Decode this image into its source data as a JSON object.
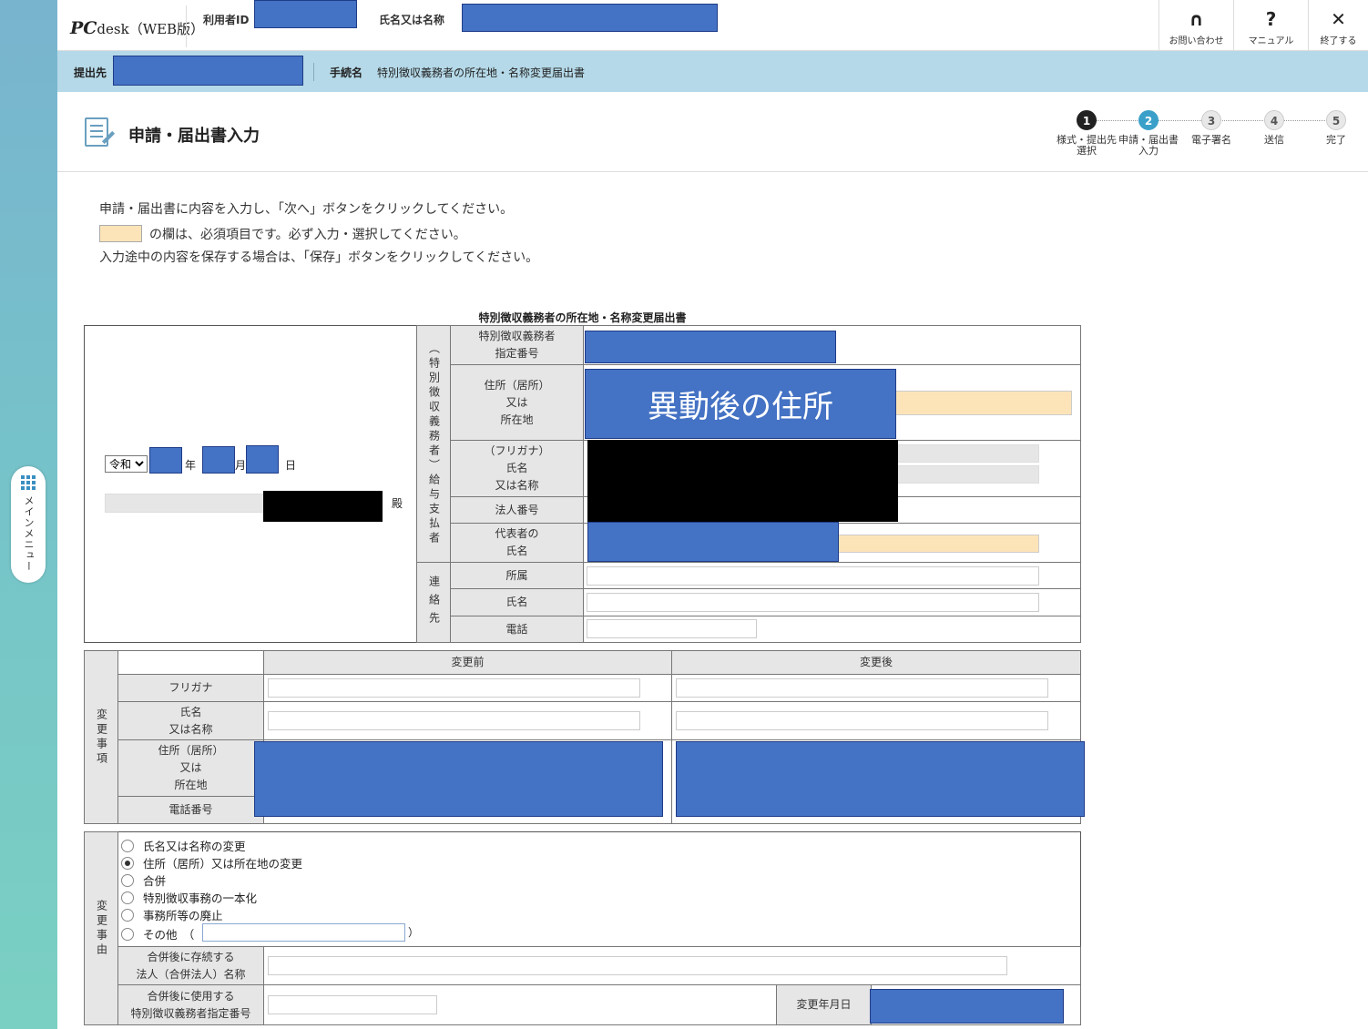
{
  "side": {
    "menu_label": "メインメニュー"
  },
  "header": {
    "logo_main": "PC",
    "logo_rest": "desk（WEB版）",
    "user_id_label": "利用者ID",
    "name_label": "氏名又は名称",
    "buttons": [
      {
        "icon": "headset-icon",
        "glyph": "🎧",
        "label": "お問い合わせ"
      },
      {
        "icon": "question-icon",
        "glyph": "?",
        "label": "マニュアル"
      },
      {
        "icon": "close-icon",
        "glyph": "✕",
        "label": "終了する"
      }
    ]
  },
  "subheader": {
    "dest_label": "提出先",
    "proc_label": "手続名",
    "proc_name": "特別徴収義務者の所在地・名称変更届出書"
  },
  "page": {
    "title": "申請・届出書入力"
  },
  "steps": [
    {
      "num": "1",
      "label": "様式・提出先\n選択",
      "state": "done"
    },
    {
      "num": "2",
      "label": "申請・届出書\n入力",
      "state": "current"
    },
    {
      "num": "3",
      "label": "電子署名",
      "state": "todo"
    },
    {
      "num": "4",
      "label": "送信",
      "state": "todo"
    },
    {
      "num": "5",
      "label": "完了",
      "state": "todo"
    }
  ],
  "instructions": {
    "line1": "申請・届出書に内容を入力し、「次へ」ボタンをクリックしてください。",
    "line2": "の欄は、必須項目です。必ず入力・選択してください。",
    "line3": "入力途中の内容を保存する場合は、「保存」ボタンをクリックしてください。"
  },
  "form": {
    "title": "特別徴収義務者の所在地・名称変更届出書",
    "era": "令和",
    "year_unit": "年",
    "month_unit": "月",
    "day_unit": "日",
    "addressee_suffix": "殿",
    "payer_group": "（特別徴収義務者）給与支払者",
    "payer_designated_no": "特別徴収義務者\n指定番号",
    "payer_address": "住所（居所）\n又は\n所在地",
    "address_annotation": "異動後の住所",
    "payer_name": "（フリガナ）\n氏名\n又は名称",
    "corp_no": "法人番号",
    "rep_name": "代表者の\n氏名",
    "contact_group": "連絡先",
    "contact_dept": "所属",
    "contact_name": "氏名",
    "contact_tel": "電話"
  },
  "changes": {
    "group": "変更事項",
    "before": "変更前",
    "after": "変更後",
    "rows": [
      "フリガナ",
      "氏名\n又は名称",
      "住所（居所）\n又は\n所在地",
      "電話番号"
    ]
  },
  "reasons": {
    "group": "変更事由",
    "options": [
      {
        "label": "氏名又は名称の変更",
        "checked": false
      },
      {
        "label": "住所（居所）又は所在地の変更",
        "checked": true
      },
      {
        "label": "合併",
        "checked": false
      },
      {
        "label": "特別徴収事務の一本化",
        "checked": false
      },
      {
        "label": "事務所等の廃止",
        "checked": false
      },
      {
        "label": "その他　（",
        "checked": false
      }
    ],
    "other_close": "）",
    "merge_corp_label": "合併後に存続する\n法人（合併法人）名称",
    "merge_no_label": "合併後に使用する\n特別徴収義務者指定番号",
    "change_date_label": "変更年月日"
  }
}
